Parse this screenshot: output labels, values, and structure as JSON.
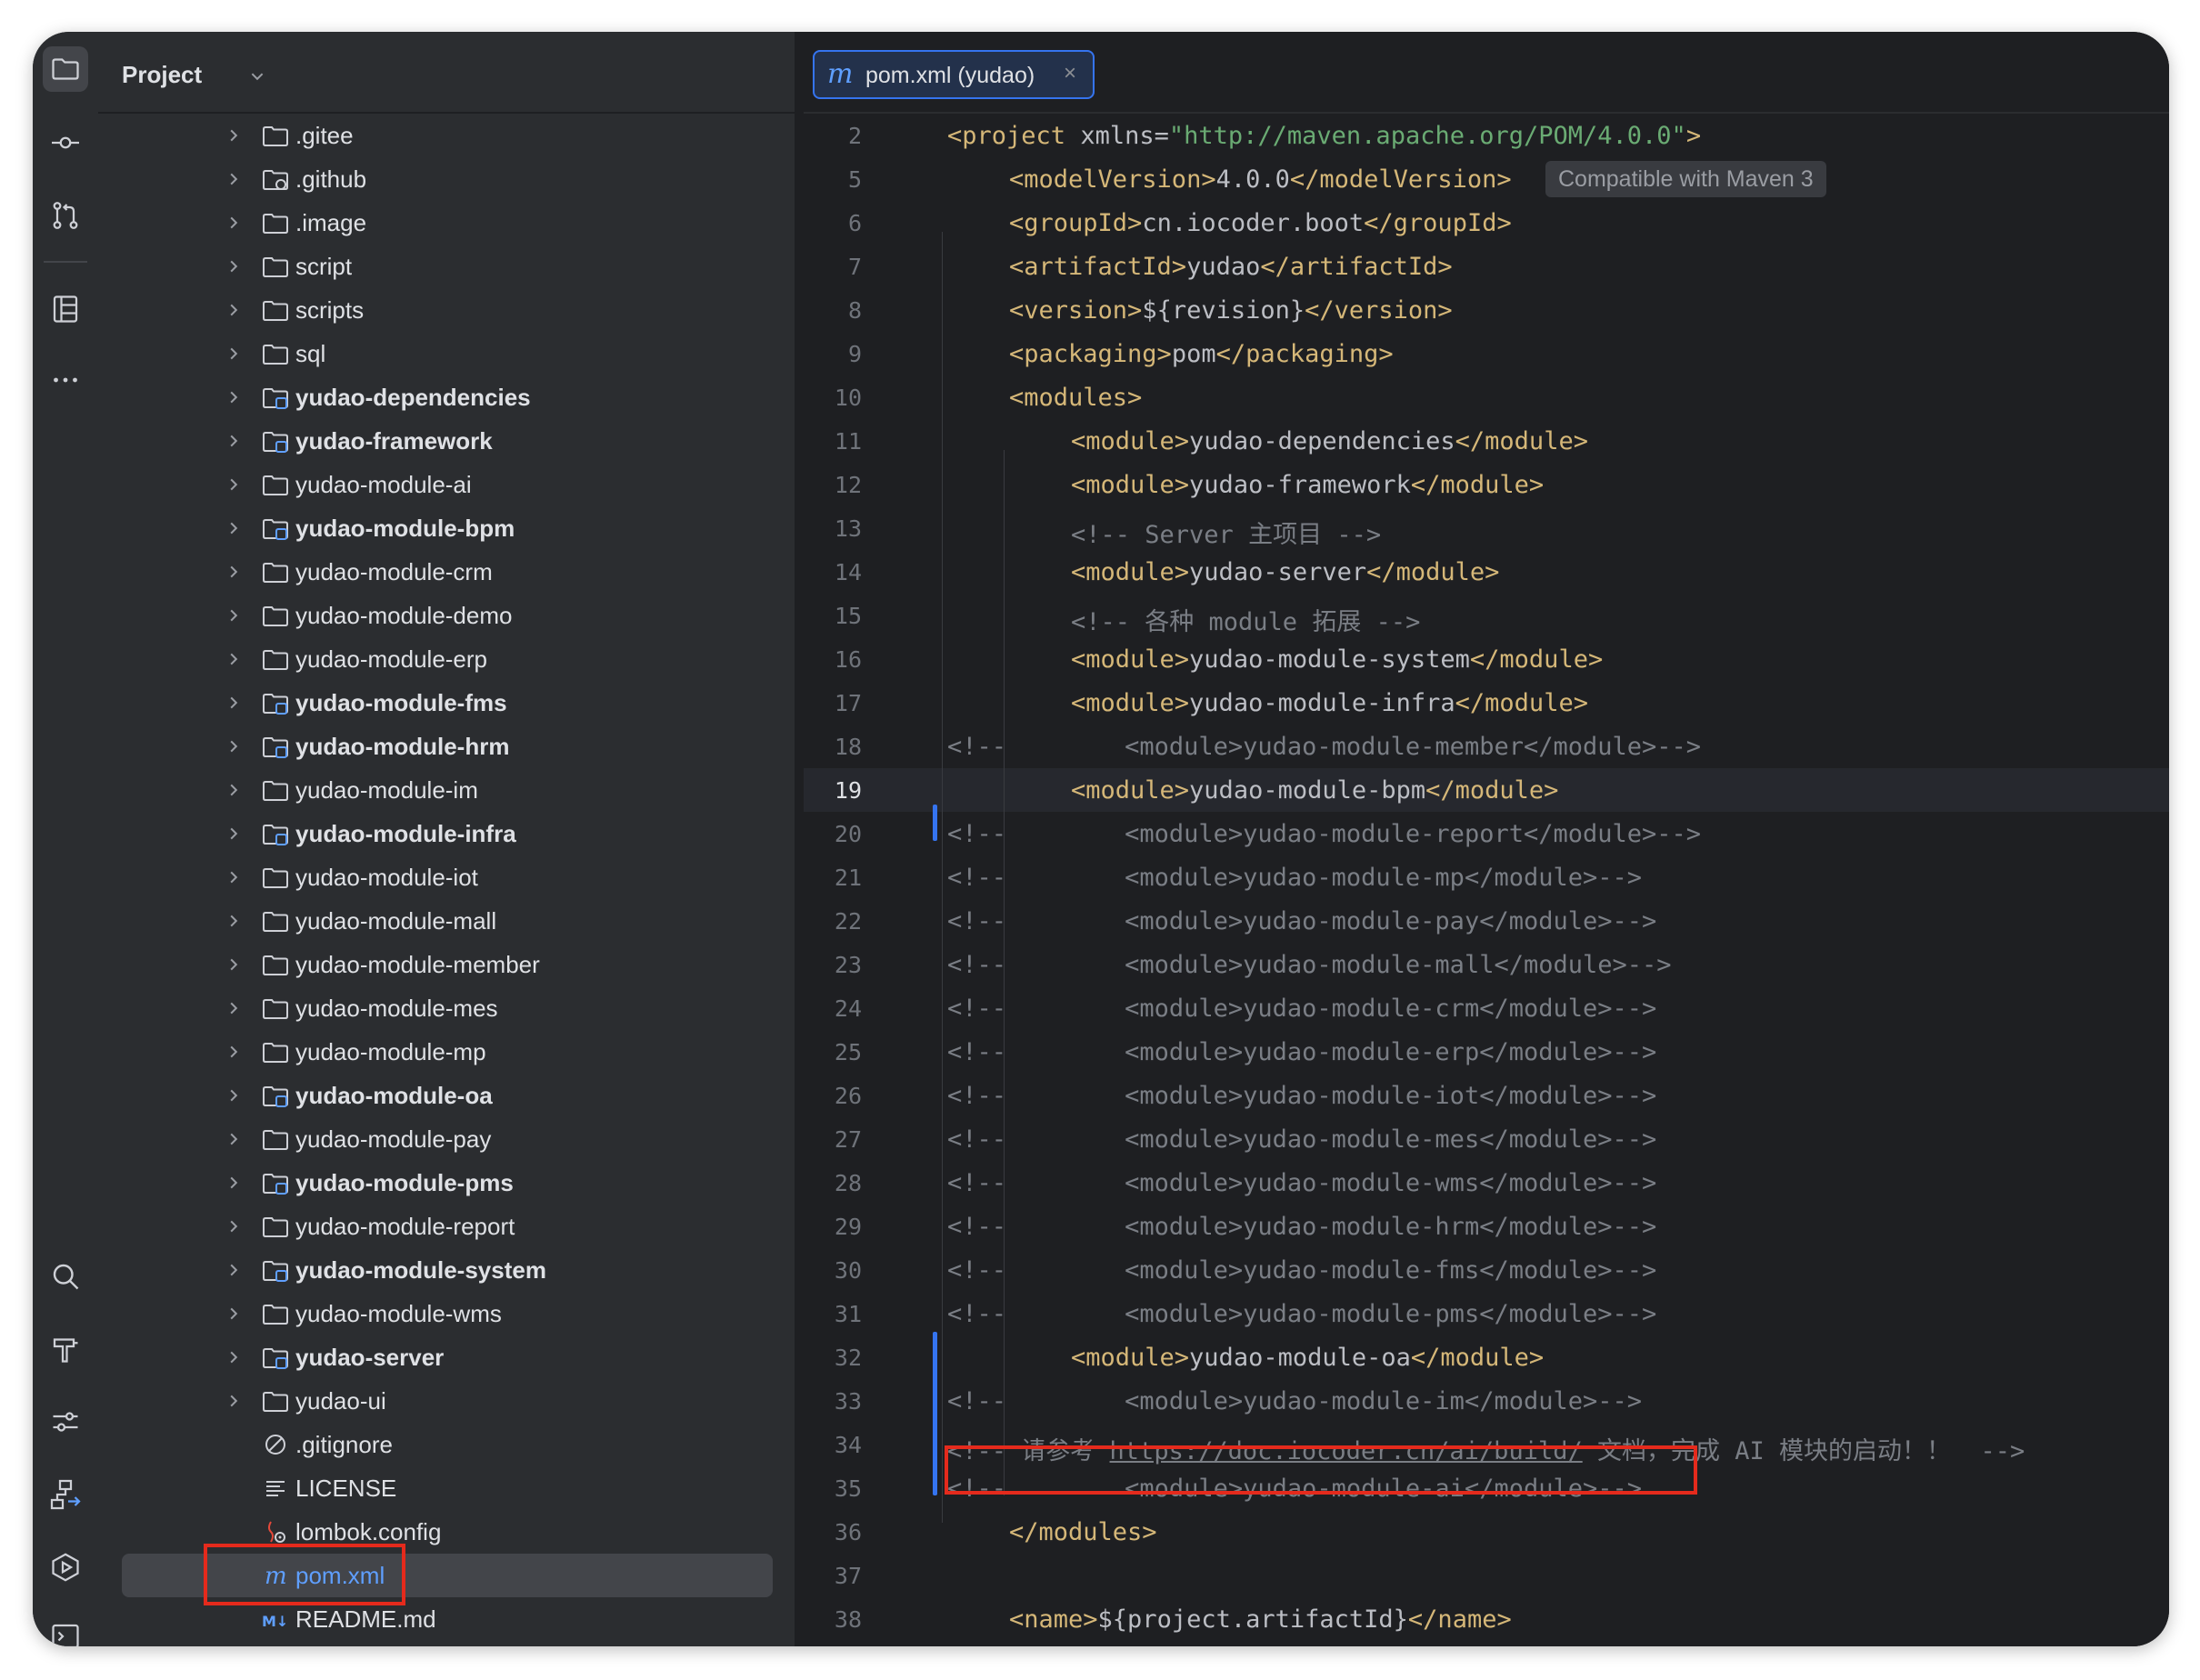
{
  "activity_bar": {
    "top_icons": [
      "folder-icon",
      "commit-icon",
      "pull-request-icon",
      "structure-icon",
      "more-icon"
    ],
    "bottom_icons": [
      "search-icon",
      "build-icon",
      "settings-icon",
      "services-icon",
      "run-icon",
      "terminal-icon"
    ]
  },
  "project_panel": {
    "title": "Project",
    "items": [
      {
        "label": ".gitee",
        "type": "folder",
        "bold": false,
        "expandable": true
      },
      {
        "label": ".github",
        "type": "folder-special",
        "bold": false,
        "expandable": true
      },
      {
        "label": ".image",
        "type": "folder",
        "bold": false,
        "expandable": true
      },
      {
        "label": "script",
        "type": "folder",
        "bold": false,
        "expandable": true
      },
      {
        "label": "scripts",
        "type": "folder",
        "bold": false,
        "expandable": true
      },
      {
        "label": "sql",
        "type": "folder",
        "bold": false,
        "expandable": true
      },
      {
        "label": "yudao-dependencies",
        "type": "module",
        "bold": true,
        "expandable": true
      },
      {
        "label": "yudao-framework",
        "type": "module",
        "bold": true,
        "expandable": true
      },
      {
        "label": "yudao-module-ai",
        "type": "folder",
        "bold": false,
        "expandable": true
      },
      {
        "label": "yudao-module-bpm",
        "type": "module",
        "bold": true,
        "expandable": true
      },
      {
        "label": "yudao-module-crm",
        "type": "folder",
        "bold": false,
        "expandable": true
      },
      {
        "label": "yudao-module-demo",
        "type": "folder",
        "bold": false,
        "expandable": true
      },
      {
        "label": "yudao-module-erp",
        "type": "folder",
        "bold": false,
        "expandable": true
      },
      {
        "label": "yudao-module-fms",
        "type": "module",
        "bold": true,
        "expandable": true
      },
      {
        "label": "yudao-module-hrm",
        "type": "module",
        "bold": true,
        "expandable": true
      },
      {
        "label": "yudao-module-im",
        "type": "folder",
        "bold": false,
        "expandable": true
      },
      {
        "label": "yudao-module-infra",
        "type": "module",
        "bold": true,
        "expandable": true
      },
      {
        "label": "yudao-module-iot",
        "type": "folder",
        "bold": false,
        "expandable": true
      },
      {
        "label": "yudao-module-mall",
        "type": "folder",
        "bold": false,
        "expandable": true
      },
      {
        "label": "yudao-module-member",
        "type": "folder",
        "bold": false,
        "expandable": true
      },
      {
        "label": "yudao-module-mes",
        "type": "folder",
        "bold": false,
        "expandable": true
      },
      {
        "label": "yudao-module-mp",
        "type": "folder",
        "bold": false,
        "expandable": true
      },
      {
        "label": "yudao-module-oa",
        "type": "module",
        "bold": true,
        "expandable": true
      },
      {
        "label": "yudao-module-pay",
        "type": "folder",
        "bold": false,
        "expandable": true
      },
      {
        "label": "yudao-module-pms",
        "type": "module",
        "bold": true,
        "expandable": true
      },
      {
        "label": "yudao-module-report",
        "type": "folder",
        "bold": false,
        "expandable": true
      },
      {
        "label": "yudao-module-system",
        "type": "module",
        "bold": true,
        "expandable": true
      },
      {
        "label": "yudao-module-wms",
        "type": "folder",
        "bold": false,
        "expandable": true
      },
      {
        "label": "yudao-server",
        "type": "module",
        "bold": true,
        "expandable": true
      },
      {
        "label": "yudao-ui",
        "type": "folder",
        "bold": false,
        "expandable": true
      },
      {
        "label": ".gitignore",
        "type": "gitignore",
        "bold": false,
        "expandable": false
      },
      {
        "label": "LICENSE",
        "type": "text",
        "bold": false,
        "expandable": false
      },
      {
        "label": "lombok.config",
        "type": "config",
        "bold": false,
        "expandable": false
      },
      {
        "label": "pom.xml",
        "type": "maven",
        "bold": false,
        "expandable": false,
        "selected": true
      },
      {
        "label": "README.md",
        "type": "markdown",
        "bold": false,
        "expandable": false
      }
    ]
  },
  "editor": {
    "tab": {
      "icon": "m",
      "label": "pom.xml (yudao)",
      "close": "×"
    },
    "inlay_hint": "Compatible with Maven 3",
    "lines": [
      {
        "num": "2",
        "indent": 0,
        "parts": [
          [
            "tag",
            "<project "
          ],
          [
            "attr",
            "xmlns="
          ],
          [
            "str",
            "\"http://maven.apache.org/POM/4.0.0\""
          ],
          [
            "tag",
            ">"
          ]
        ]
      },
      {
        "num": "5",
        "indent": 1,
        "parts": [
          [
            "tag",
            "<modelVersion>"
          ],
          [
            "attr",
            "4.0.0"
          ],
          [
            "tag",
            "</modelVersion>"
          ]
        ]
      },
      {
        "num": "6",
        "indent": 1,
        "parts": [
          [
            "tag",
            "<groupId>"
          ],
          [
            "attr",
            "cn.iocoder.boot"
          ],
          [
            "tag",
            "</groupId>"
          ]
        ]
      },
      {
        "num": "7",
        "indent": 1,
        "parts": [
          [
            "tag",
            "<artifactId>"
          ],
          [
            "attr",
            "yudao"
          ],
          [
            "tag",
            "</artifactId>"
          ]
        ]
      },
      {
        "num": "8",
        "indent": 1,
        "parts": [
          [
            "tag",
            "<version>"
          ],
          [
            "attr",
            "${revision}"
          ],
          [
            "tag",
            "</version>"
          ]
        ]
      },
      {
        "num": "9",
        "indent": 1,
        "parts": [
          [
            "tag",
            "<packaging>"
          ],
          [
            "attr",
            "pom"
          ],
          [
            "tag",
            "</packaging>"
          ]
        ]
      },
      {
        "num": "10",
        "indent": 1,
        "parts": [
          [
            "tag",
            "<modules>"
          ]
        ]
      },
      {
        "num": "11",
        "indent": 2,
        "parts": [
          [
            "tag",
            "<module>"
          ],
          [
            "attr",
            "yudao-dependencies"
          ],
          [
            "tag",
            "</module>"
          ]
        ]
      },
      {
        "num": "12",
        "indent": 2,
        "parts": [
          [
            "tag",
            "<module>"
          ],
          [
            "attr",
            "yudao-framework"
          ],
          [
            "tag",
            "</module>"
          ]
        ]
      },
      {
        "num": "13",
        "indent": 2,
        "parts": [
          [
            "com",
            "<!-- Server 主项目 -->"
          ]
        ]
      },
      {
        "num": "14",
        "indent": 2,
        "parts": [
          [
            "tag",
            "<module>"
          ],
          [
            "attr",
            "yudao-server"
          ],
          [
            "tag",
            "</module>"
          ]
        ]
      },
      {
        "num": "15",
        "indent": 2,
        "parts": [
          [
            "com",
            "<!-- 各种 module 拓展 -->"
          ]
        ]
      },
      {
        "num": "16",
        "indent": 2,
        "parts": [
          [
            "tag",
            "<module>"
          ],
          [
            "attr",
            "yudao-module-system"
          ],
          [
            "tag",
            "</module>"
          ]
        ]
      },
      {
        "num": "17",
        "indent": 2,
        "parts": [
          [
            "tag",
            "<module>"
          ],
          [
            "attr",
            "yudao-module-infra"
          ],
          [
            "tag",
            "</module>"
          ]
        ]
      },
      {
        "num": "18",
        "indent": 0,
        "parts": [
          [
            "com",
            "<!--        <module>yudao-module-member</module>-->"
          ]
        ]
      },
      {
        "num": "19",
        "indent": 2,
        "current": true,
        "parts": [
          [
            "tag",
            "<module>"
          ],
          [
            "attr",
            "yudao-module-bpm"
          ],
          [
            "tag",
            "</module>"
          ]
        ]
      },
      {
        "num": "20",
        "indent": 0,
        "parts": [
          [
            "com",
            "<!--        <module>yudao-module-report</module>-->"
          ]
        ]
      },
      {
        "num": "21",
        "indent": 0,
        "parts": [
          [
            "com",
            "<!--        <module>yudao-module-mp</module>-->"
          ]
        ]
      },
      {
        "num": "22",
        "indent": 0,
        "parts": [
          [
            "com",
            "<!--        <module>yudao-module-pay</module>-->"
          ]
        ]
      },
      {
        "num": "23",
        "indent": 0,
        "parts": [
          [
            "com",
            "<!--        <module>yudao-module-mall</module>-->"
          ]
        ]
      },
      {
        "num": "24",
        "indent": 0,
        "parts": [
          [
            "com",
            "<!--        <module>yudao-module-crm</module>-->"
          ]
        ]
      },
      {
        "num": "25",
        "indent": 0,
        "parts": [
          [
            "com",
            "<!--        <module>yudao-module-erp</module>-->"
          ]
        ]
      },
      {
        "num": "26",
        "indent": 0,
        "parts": [
          [
            "com",
            "<!--        <module>yudao-module-iot</module>-->"
          ]
        ]
      },
      {
        "num": "27",
        "indent": 0,
        "parts": [
          [
            "com",
            "<!--        <module>yudao-module-mes</module>-->"
          ]
        ]
      },
      {
        "num": "28",
        "indent": 0,
        "parts": [
          [
            "com",
            "<!--        <module>yudao-module-wms</module>-->"
          ]
        ]
      },
      {
        "num": "29",
        "indent": 0,
        "parts": [
          [
            "com",
            "<!--        <module>yudao-module-hrm</module>-->"
          ]
        ]
      },
      {
        "num": "30",
        "indent": 0,
        "parts": [
          [
            "com",
            "<!--        <module>yudao-module-fms</module>-->"
          ]
        ]
      },
      {
        "num": "31",
        "indent": 0,
        "parts": [
          [
            "com",
            "<!--        <module>yudao-module-pms</module>-->"
          ]
        ]
      },
      {
        "num": "32",
        "indent": 2,
        "parts": [
          [
            "tag",
            "<module>"
          ],
          [
            "attr",
            "yudao-module-oa"
          ],
          [
            "tag",
            "</module>"
          ]
        ]
      },
      {
        "num": "33",
        "indent": 0,
        "parts": [
          [
            "com",
            "<!--        <module>yudao-module-im</module>-->"
          ]
        ]
      },
      {
        "num": "34",
        "indent": 0,
        "parts": [
          [
            "com",
            "<!-- 请参考 "
          ],
          [
            "link",
            "https://doc.iocoder.cn/ai/build/"
          ],
          [
            "com",
            " 文档，完成 AI 模块的启动！！  -->"
          ]
        ]
      },
      {
        "num": "35",
        "indent": 0,
        "parts": [
          [
            "com",
            "<!--        <module>yudao-module-ai</module>-->"
          ]
        ]
      },
      {
        "num": "36",
        "indent": 1,
        "parts": [
          [
            "tag",
            "</modules>"
          ]
        ]
      },
      {
        "num": "37",
        "indent": 0,
        "parts": []
      },
      {
        "num": "38",
        "indent": 1,
        "parts": [
          [
            "tag",
            "<name>"
          ],
          [
            "attr",
            "${project.artifactId}"
          ],
          [
            "tag",
            "</name>"
          ]
        ]
      }
    ]
  },
  "colors": {
    "accent": "#3574f0",
    "highlight_box": "#e52a1c",
    "xml_tag": "#d5b778",
    "xml_string": "#6aab73",
    "comment": "#7a7e85"
  }
}
